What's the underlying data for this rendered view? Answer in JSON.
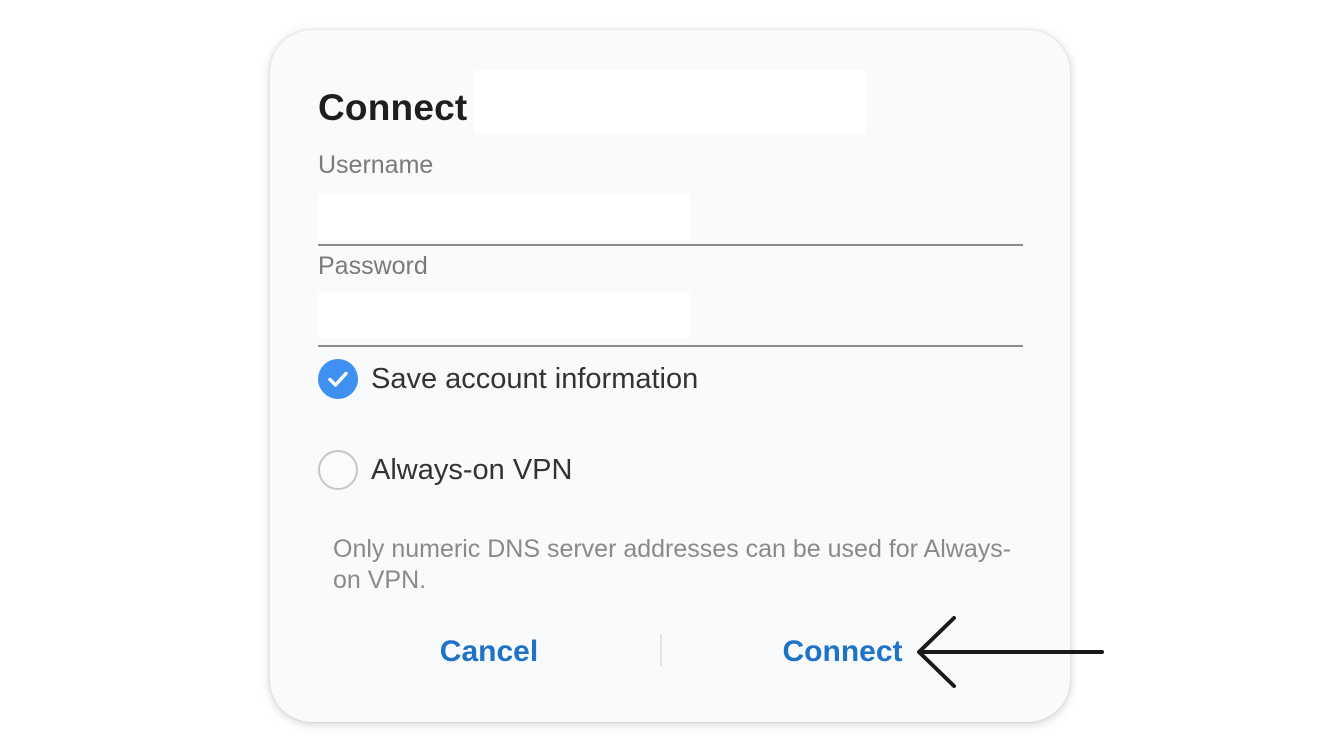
{
  "dialog": {
    "title": "Connect",
    "username_label": "Username",
    "password_label": "Password",
    "save_account": {
      "label": "Save account information",
      "checked": true
    },
    "always_on_vpn": {
      "label": "Always-on VPN",
      "checked": false
    },
    "note": "Only numeric DNS server addresses can be used for Always-on VPN.",
    "cancel_label": "Cancel",
    "connect_label": "Connect"
  },
  "colors": {
    "accent": "#3e91f0",
    "button_text": "#1f72c6",
    "dialog_bg": "#f9fafc"
  },
  "annotation": {
    "icon": "left-arrow-icon"
  }
}
